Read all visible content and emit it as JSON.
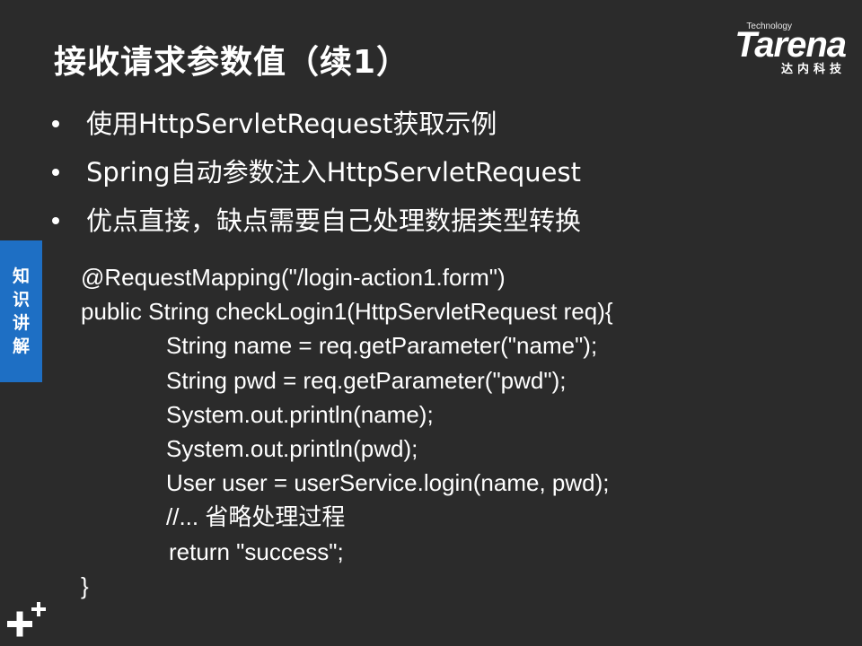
{
  "slide": {
    "title": "接收请求参数值（续1）",
    "logo": {
      "small": "Technology",
      "word": "Tarena",
      "cn": "达内科技"
    },
    "bullets": [
      "使用HttpServletRequest获取示例",
      "Spring自动参数注入HttpServletRequest",
      "优点直接，缺点需要自己处理数据类型转换"
    ],
    "side_tab": [
      "知",
      "识",
      "讲",
      "解"
    ],
    "code_lines": [
      "@RequestMapping(\"/login-action1.form\")",
      "public String checkLogin1(HttpServletRequest req){",
      "String name = req.getParameter(\"name\");",
      "String pwd = req.getParameter(\"pwd\");",
      "System.out.println(name);",
      "System.out.println(pwd);",
      "User user = userService.login(name, pwd);",
      "//...  省略处理过程",
      "return \"success\";",
      "}"
    ]
  }
}
